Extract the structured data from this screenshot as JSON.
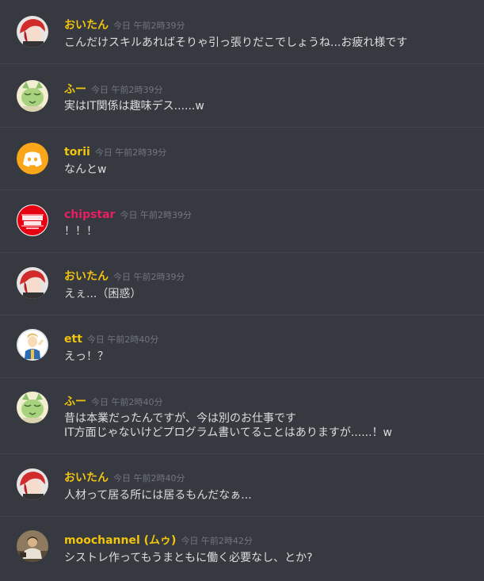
{
  "colors": {
    "background": "#36393f",
    "divider": "#40444b",
    "text": "#dcddde",
    "timestamp": "#72767d",
    "name_gold": "#f1c40f",
    "name_pink": "#e91e63"
  },
  "messages": [
    {
      "author": "おいたん",
      "name_color": "#f1c40f",
      "avatar": "anime-red-hair-avatar",
      "time": "今日 午前2時39分",
      "lines": [
        "こんだけスキルあればそりゃ引っ張りだこでしょうね...お疲れ様です"
      ]
    },
    {
      "author": "ふー",
      "name_color": "#f1c40f",
      "avatar": "green-cat-avatar",
      "time": "今日 午前2時39分",
      "lines": [
        "実はIT関係は趣味デス......w"
      ]
    },
    {
      "author": "torii",
      "name_color": "#f1c40f",
      "avatar": "discord-logo-avatar",
      "time": "今日 午前2時39分",
      "lines": [
        "なんとw"
      ]
    },
    {
      "author": "chipstar",
      "name_color": "#e91e63",
      "avatar": "chipstar-logo-avatar",
      "time": "今日 午前2時39分",
      "lines": [
        "！！！"
      ]
    },
    {
      "author": "おいたん",
      "name_color": "#f1c40f",
      "avatar": "anime-red-hair-avatar",
      "time": "今日 午前2時39分",
      "lines": [
        "えぇ...（困惑）"
      ]
    },
    {
      "author": "ett",
      "name_color": "#f1c40f",
      "avatar": "vault-boy-avatar",
      "time": "今日 午前2時40分",
      "lines": [
        "えっ！？"
      ]
    },
    {
      "author": "ふー",
      "name_color": "#f1c40f",
      "avatar": "green-cat-avatar",
      "time": "今日 午前2時40分",
      "lines": [
        "昔は本業だったんですが、今は別のお仕事です",
        "IT方面じゃないけどプログラム書いてることはありますが......！w"
      ]
    },
    {
      "author": "おいたん",
      "name_color": "#f1c40f",
      "avatar": "anime-red-hair-avatar",
      "time": "今日 午前2時40分",
      "lines": [
        "人材って居る所には居るもんだなぁ..."
      ]
    },
    {
      "author": "moochannel (ムゥ)",
      "name_color": "#f1c40f",
      "avatar": "photo-person-avatar",
      "time": "今日 午前2時42分",
      "lines": [
        "シストレ作ってもうまともに働く必要なし、とか?"
      ]
    }
  ]
}
